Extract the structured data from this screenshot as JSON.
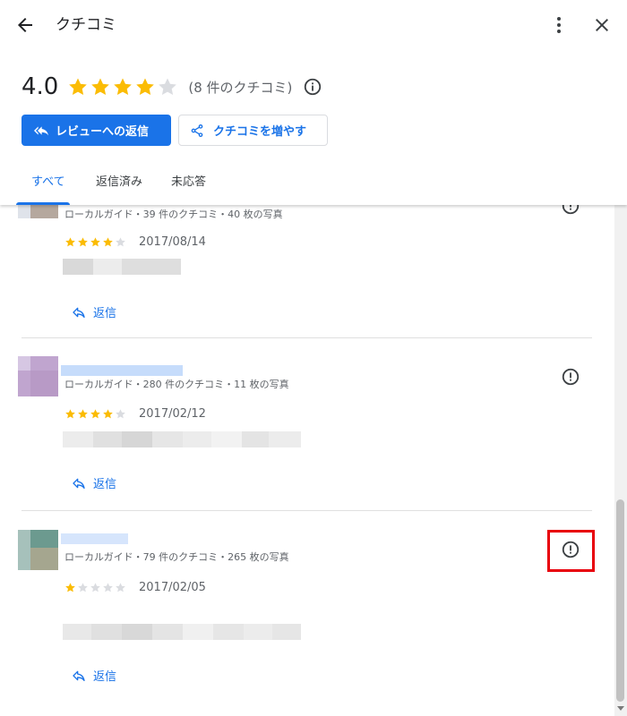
{
  "header": {
    "title": "クチコミ",
    "back_icon": "arrow-back-icon",
    "more_icon": "more-vert-icon",
    "close_icon": "close-icon"
  },
  "summary": {
    "average": "4.0",
    "stars_filled": 4,
    "stars_total": 5,
    "count_text": "(8 件のクチコミ)",
    "info_icon": "info-icon"
  },
  "buttons": {
    "reply_label": "レビューへの返信",
    "more_reviews_label": "クチコミを増やす"
  },
  "tabs": [
    {
      "label": "すべて",
      "active": true
    },
    {
      "label": "返信済み",
      "active": false
    },
    {
      "label": "未応答",
      "active": false
    }
  ],
  "reviews": [
    {
      "meta": "ローカルガイド・39 件のクチコミ・40 枚の写真",
      "rating": 4,
      "date": "2017/08/14",
      "reply_label": "返信"
    },
    {
      "meta": "ローカルガイド・280 件のクチコミ・11 枚の写真",
      "rating": 4,
      "date": "2017/02/12",
      "reply_label": "返信"
    },
    {
      "meta": "ローカルガイド・79 件のクチコミ・265 枚の写真",
      "rating": 1,
      "date": "2017/02/05",
      "reply_label": "返信"
    }
  ],
  "colors": {
    "accent": "#1a73e8",
    "star": "#fbbc04",
    "star_empty": "#dadce0",
    "highlight": "#e8000b"
  }
}
